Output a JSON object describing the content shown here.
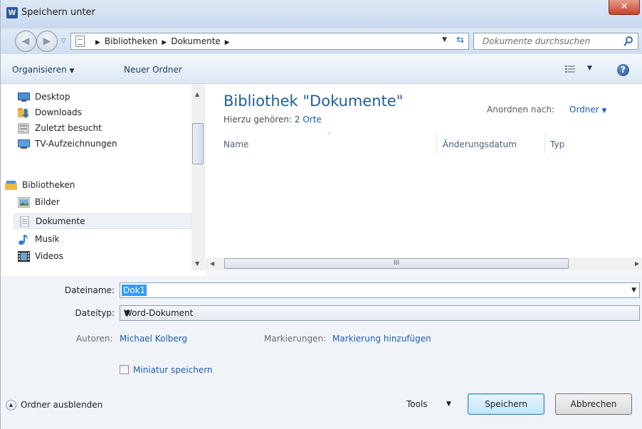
{
  "window": {
    "title": "Speichern unter",
    "app_icon": "W",
    "close_glyph": "✕"
  },
  "nav": {
    "breadcrumb": [
      "Bibliotheken",
      "Dokumente"
    ],
    "search_placeholder": "Dokumente durchsuchen"
  },
  "toolbar": {
    "organize": "Organisieren",
    "new_folder": "Neuer Ordner"
  },
  "navpane": {
    "items": [
      {
        "label": "Desktop",
        "icon": "desktop-icon"
      },
      {
        "label": "Downloads",
        "icon": "downloads-icon"
      },
      {
        "label": "Zuletzt besucht",
        "icon": "recent-places-icon"
      },
      {
        "label": "TV-Aufzeichnungen",
        "icon": "tv-icon"
      },
      {
        "label": "Bibliotheken",
        "icon": "library-icon"
      },
      {
        "label": "Bilder",
        "icon": "pictures-icon"
      },
      {
        "label": "Dokumente",
        "icon": "documents-icon",
        "selected": true
      },
      {
        "label": "Musik",
        "icon": "music-icon"
      },
      {
        "label": "Videos",
        "icon": "videos-icon"
      }
    ]
  },
  "main": {
    "title": "Bibliothek \"Dokumente\"",
    "includes_label": "Hierzu gehören:",
    "includes_link": "2 Orte",
    "arrange_label": "Anordnen nach:",
    "arrange_value": "Ordner",
    "columns": [
      "Name",
      "Änderungsdatum",
      "Typ"
    ],
    "hscroll_grip": "III"
  },
  "form": {
    "filename_label": "Dateiname:",
    "filename_value": "Dok1",
    "filetype_label": "Dateityp:",
    "filetype_value": "Word-Dokument",
    "authors_label": "Autoren:",
    "authors_value": "Michael Kolberg",
    "tags_label": "Markierungen:",
    "tags_value": "Markierung hinzufügen",
    "thumbnail_label": "Miniatur speichern",
    "thumbnail_checked": false
  },
  "footer": {
    "hide_folders": "Ordner ausblenden",
    "tools": "Tools",
    "save": "Speichern",
    "cancel": "Abbrechen"
  }
}
